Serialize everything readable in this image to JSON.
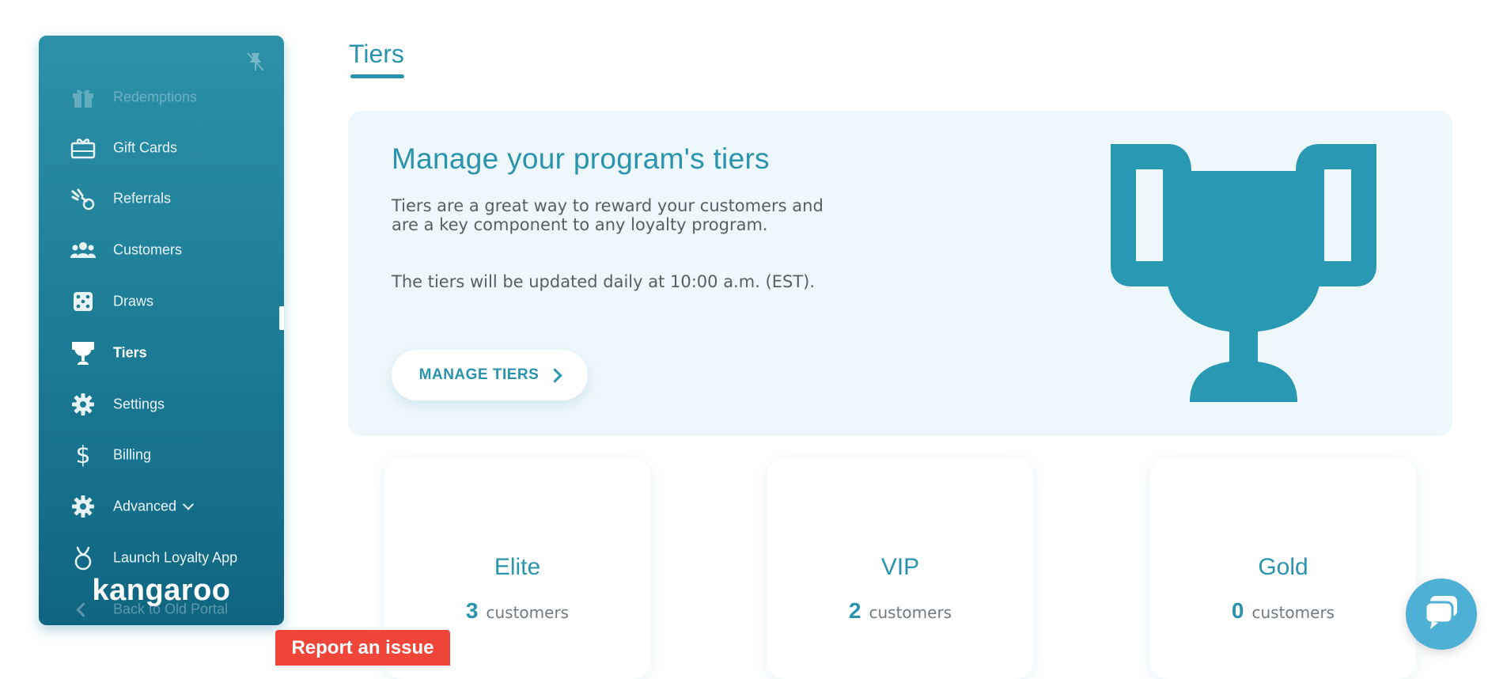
{
  "sidebar": {
    "items": [
      {
        "label": "Redemptions",
        "icon": "gift-icon"
      },
      {
        "label": "Gift Cards",
        "icon": "gift-card-icon"
      },
      {
        "label": "Referrals",
        "icon": "referrals-icon"
      },
      {
        "label": "Customers",
        "icon": "users-icon"
      },
      {
        "label": "Draws",
        "icon": "dice-icon"
      },
      {
        "label": "Tiers",
        "icon": "trophy-icon"
      },
      {
        "label": "Settings",
        "icon": "gear-icon"
      },
      {
        "label": "Billing",
        "icon": "dollar-icon"
      },
      {
        "label": "Advanced",
        "icon": "gear-icon"
      },
      {
        "label": "Launch Loyalty App",
        "icon": "kangaroo-app-icon"
      },
      {
        "label": "Back to Old Portal",
        "icon": "chevron-left-icon"
      }
    ],
    "brand": "kangaroo"
  },
  "page": {
    "title": "Tiers"
  },
  "hero": {
    "title": "Manage your program's tiers",
    "text1": "Tiers are a great way to reward your customers and are a key component to any loyalty program.",
    "text2": "The tiers will be updated daily at 10:00 a.m. (EST).",
    "button": "MANAGE TIERS"
  },
  "tiers": [
    {
      "name": "Elite",
      "count": "3",
      "unit": "customers"
    },
    {
      "name": "VIP",
      "count": "2",
      "unit": "customers"
    },
    {
      "name": "Gold",
      "count": "0",
      "unit": "customers"
    }
  ],
  "report": {
    "label": "Report an issue"
  },
  "colors": {
    "accent": "#2a93ad",
    "report": "#f0463a",
    "chat": "#4fb0d6"
  }
}
